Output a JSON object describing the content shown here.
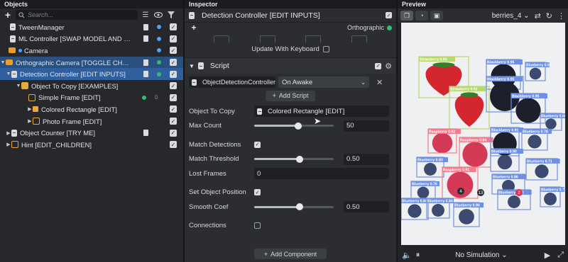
{
  "objects": {
    "title": "Objects",
    "search_placeholder": "Search...",
    "items": [
      {
        "label": "TweenManager"
      },
      {
        "label": "ML Controller [SWAP MODEL AND LABELS]"
      },
      {
        "label": "Camera"
      },
      {
        "label": "Orthographic Camera [TOGGLE CHILDREN]"
      },
      {
        "label": "Detection Controller [EDIT INPUTS]"
      },
      {
        "label": "Object To Copy [EXAMPLES]"
      },
      {
        "label": "Simple Frame [EDIT]",
        "count": "0"
      },
      {
        "label": "Colored Rectangle [EDIT]"
      },
      {
        "label": "Photo Frame  [EDIT]"
      },
      {
        "label": "Object Counter [TRY ME]"
      },
      {
        "label": "Hint [EDIT_CHILDREN]"
      }
    ]
  },
  "inspector": {
    "title": "Inspector",
    "object_name": "Detection Controller [EDIT INPUTS]",
    "camera_mode": "Orthographic",
    "update_with_keyboard": "Update With Keyboard",
    "script_header": "Script",
    "script_file": "ObjectDetectionController",
    "script_event": "On Awake",
    "add_script": "Add Script",
    "props": {
      "object_to_copy_label": "Object To Copy",
      "object_to_copy_value": "Colored Rectangle [EDIT]",
      "max_count_label": "Max Count",
      "max_count_value": "50",
      "max_count_fraction": 0.55,
      "match_detections_label": "Match Detections",
      "match_threshold_label": "Match Threshold",
      "match_threshold_value": "0.50",
      "match_threshold_fraction": 0.57,
      "lost_frames_label": "Lost Frames",
      "lost_frames_value": "0",
      "set_object_position_label": "Set Object Position",
      "smooth_coef_label": "Smooth Coef",
      "smooth_coef_value": "0.50",
      "smooth_coef_fraction": 0.57,
      "connections_label": "Connections"
    },
    "add_component": "Add Component"
  },
  "preview": {
    "title": "Preview",
    "scene": "berries_4",
    "simulation": "No Simulation",
    "detections": [
      {
        "label": "Strawberry 0.84",
        "kind": "strawberry"
      },
      {
        "label": "Strawberry 0.91",
        "kind": "strawberry"
      },
      {
        "label": "Blueberry 0.53",
        "kind": "blueberry"
      },
      {
        "label": "Blackberry 0.95",
        "kind": "blackberry"
      },
      {
        "label": "Blackberry 0.95",
        "kind": "blackberry"
      },
      {
        "label": "Blackberry 0.95",
        "kind": "blackberry"
      },
      {
        "label": "Blueberry 0.68",
        "kind": "blueberry"
      },
      {
        "label": "Raspberry 0.92",
        "kind": "raspberry"
      },
      {
        "label": "Raspberry 0.94",
        "kind": "raspberry"
      },
      {
        "label": "Blackberry 0.91",
        "kind": "blackberry"
      },
      {
        "label": "Blueberry 0.78",
        "kind": "blueberry"
      },
      {
        "label": "Blueberry 0.90",
        "kind": "blueberry"
      },
      {
        "label": "Blueberry 0.83",
        "kind": "blueberry"
      },
      {
        "label": "Raspberry 0.91",
        "kind": "raspberry"
      },
      {
        "label": "Blueberry 0.71",
        "kind": "blueberry"
      },
      {
        "label": "Blueberry 0.86",
        "kind": "blueberry"
      },
      {
        "label": "Blueberry 0.76",
        "kind": "blueberry"
      },
      {
        "label": "Blueberry 0.84",
        "kind": "blueberry"
      },
      {
        "label": "Blueberry 0.92",
        "kind": "blueberry"
      },
      {
        "label": "Blueberry 0.72",
        "kind": "blueberry"
      },
      {
        "label": "Blueberry 0.84",
        "kind": "blueberry"
      },
      {
        "label": "Blueberry 0.90",
        "kind": "blueberry"
      }
    ],
    "markers": [
      "4",
      "13",
      "2"
    ]
  },
  "colors": {
    "selection": "#2f5f9d",
    "strawberry_box": "#b7d86a",
    "blueberry_box": "#6f8fe0",
    "raspberry_box": "#f07c8c",
    "blackberry_box": "#6f8fe0"
  }
}
